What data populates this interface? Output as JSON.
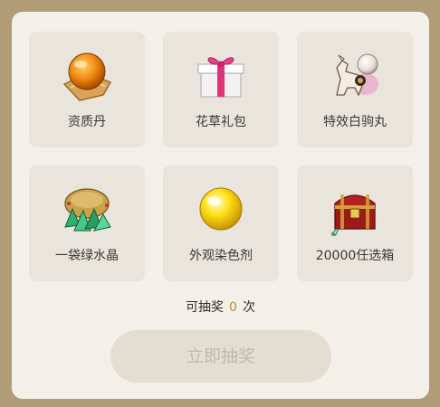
{
  "items": [
    {
      "label": "资质丹",
      "icon": "orange-orb-icon"
    },
    {
      "label": "花草礼包",
      "icon": "gift-box-icon"
    },
    {
      "label": "特效白驹丸",
      "icon": "white-horse-pearl-icon"
    },
    {
      "label": "一袋绿水晶",
      "icon": "green-crystal-bag-icon"
    },
    {
      "label": "外观染色剂",
      "icon": "yellow-dye-orb-icon"
    },
    {
      "label": "20000任选箱",
      "icon": "treasure-chest-icon"
    }
  ],
  "draw_count": {
    "prefix": "可抽奖",
    "value": "0",
    "suffix": "次"
  },
  "draw_button": {
    "label": "立即抽奖",
    "disabled": true
  },
  "colors": {
    "background": "#b09c77",
    "panel": "#f3f0ea",
    "cell": "#e9e4dc",
    "accent_number": "#b18c3c",
    "button_disabled": "#e3ddd2"
  }
}
